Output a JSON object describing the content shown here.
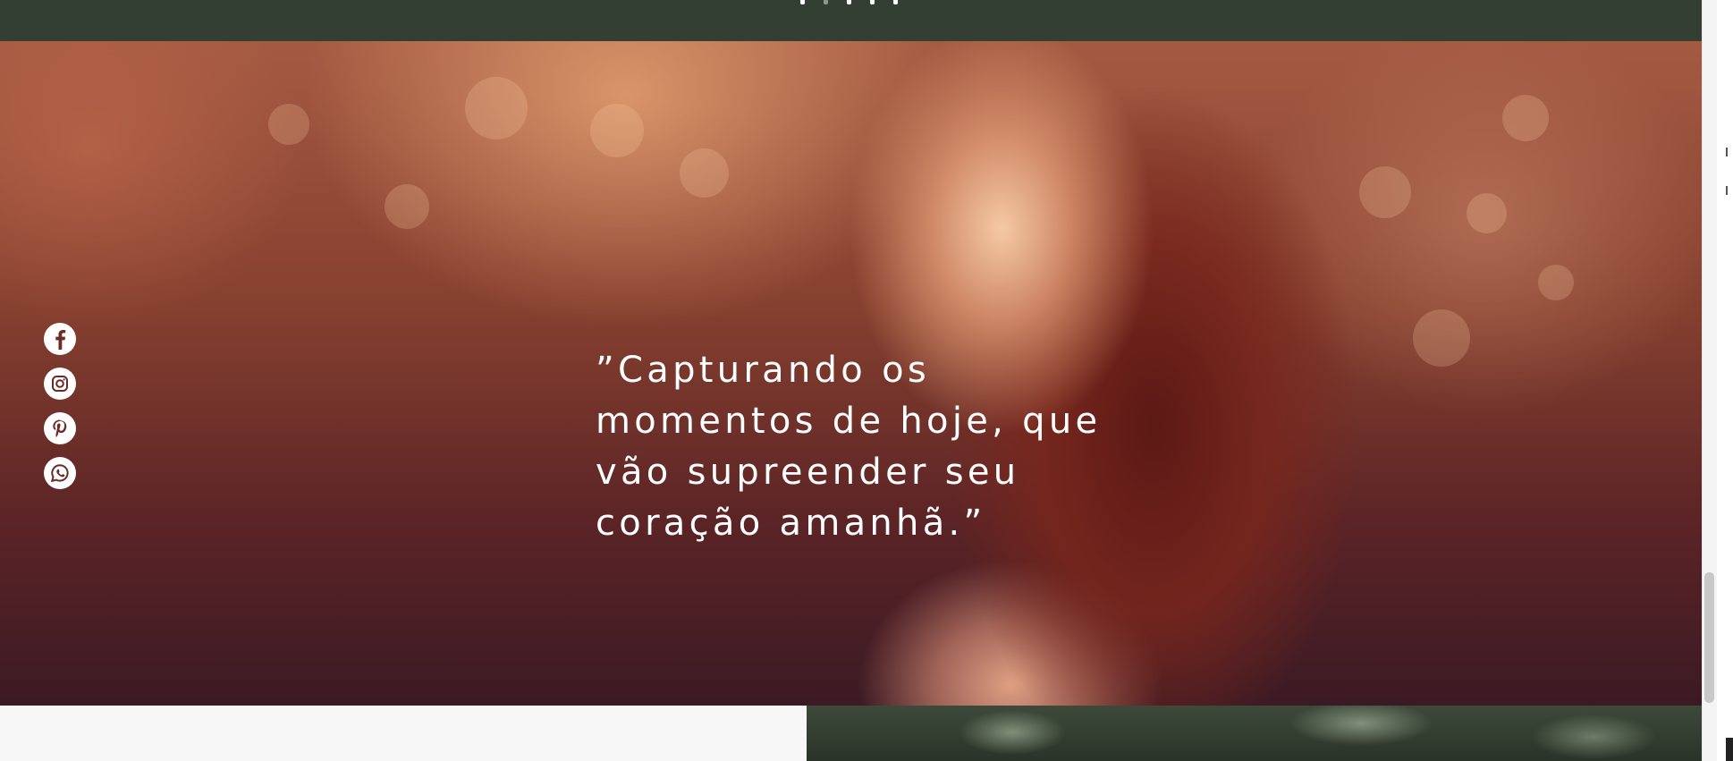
{
  "header": {
    "slide_dots": [
      {
        "icon": "slide-dot",
        "active": false
      },
      {
        "icon": "slide-dot",
        "active": true
      },
      {
        "icon": "slide-dot",
        "active": false
      },
      {
        "icon": "slide-dot",
        "active": false
      },
      {
        "icon": "slide-dot",
        "active": false
      }
    ]
  },
  "hero": {
    "quote": "”Capturando os\nmomentos de hoje, que\nvão supreender seu\ncoração amanhã.”"
  },
  "social_bar": {
    "links": [
      {
        "icon": "facebook-icon"
      },
      {
        "icon": "instagram-icon"
      },
      {
        "icon": "pinterest-icon"
      },
      {
        "icon": "whatsapp-icon"
      }
    ]
  },
  "colors": {
    "header_bg": "#343f34",
    "quote_text": "#ffffff",
    "social_icon_bg": "#ffffff",
    "social_icon_fg": "#6b2a26",
    "bottom_panel_bg": "#f6f7f6"
  }
}
